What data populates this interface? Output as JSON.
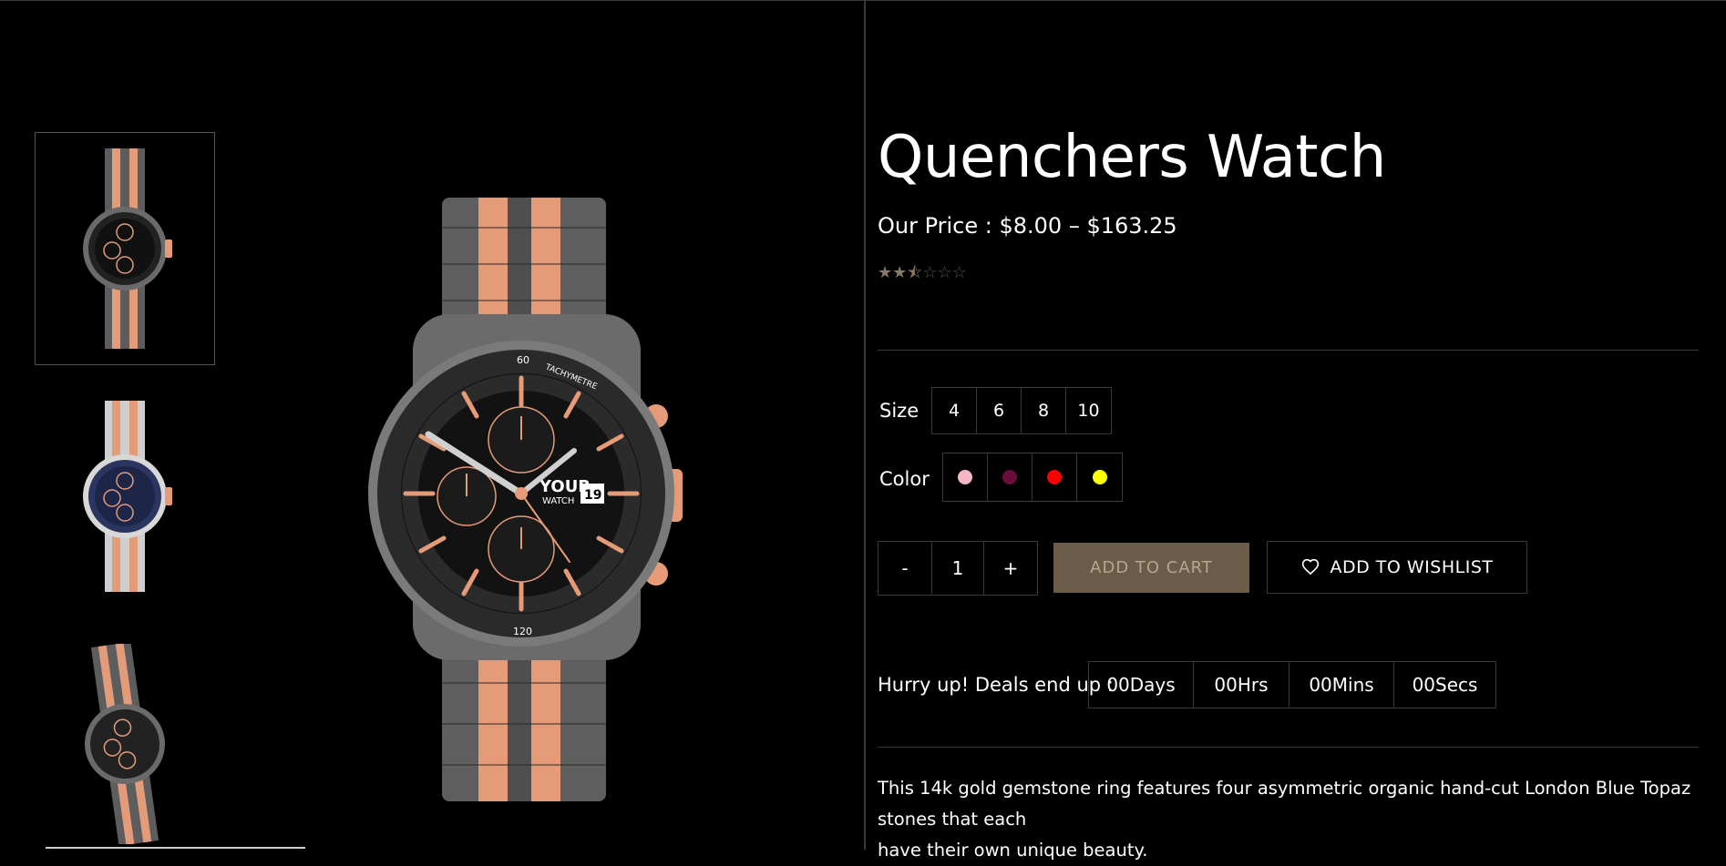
{
  "product": {
    "title": "Quenchers Watch",
    "price_label": "Our Price : $8.00 – $163.25",
    "rating_value": 2.5,
    "rating_max": 5,
    "description_line1": "This 14k gold gemstone ring features four asymmetric organic hand-cut London Blue Topaz stones that each",
    "description_line2": "have their own unique beauty."
  },
  "gallery": {
    "thumbnails": [
      {
        "variant": "black-rosegold"
      },
      {
        "variant": "navy-silver"
      },
      {
        "variant": "black-rosegold-angled"
      }
    ],
    "main_watch": {
      "dial_text_1": "YOUR",
      "dial_text_2": "WATCH",
      "date": "19",
      "bezel_top": "60",
      "bezel_bottom": "120",
      "bezel_label": "TACHYMETRE"
    }
  },
  "options": {
    "size_label": "Size",
    "sizes": [
      "4",
      "6",
      "8",
      "10"
    ],
    "color_label": "Color",
    "colors": [
      {
        "name": "pink",
        "hex": "#f4b8c4"
      },
      {
        "name": "maroon",
        "hex": "#6a0d3c"
      },
      {
        "name": "red",
        "hex": "#ff0000"
      },
      {
        "name": "yellow",
        "hex": "#ffff00"
      }
    ]
  },
  "cart": {
    "minus": "-",
    "quantity": "1",
    "plus": "+",
    "add_to_cart": "ADD TO CART",
    "add_to_wishlist": "ADD TO WISHLIST"
  },
  "deal": {
    "label": "Hurry up! Deals end up :",
    "days": "00Days",
    "hours": "00Hrs",
    "mins": "00Mins",
    "secs": "00Secs"
  },
  "colors": {
    "background": "#000000",
    "accent": "#6b5b49",
    "border": "#3a3a3a",
    "rose_gold": "#e79a78",
    "steel": "#6d6d6d"
  },
  "icons": {
    "heart": "heart-icon",
    "star": "star-icon"
  }
}
